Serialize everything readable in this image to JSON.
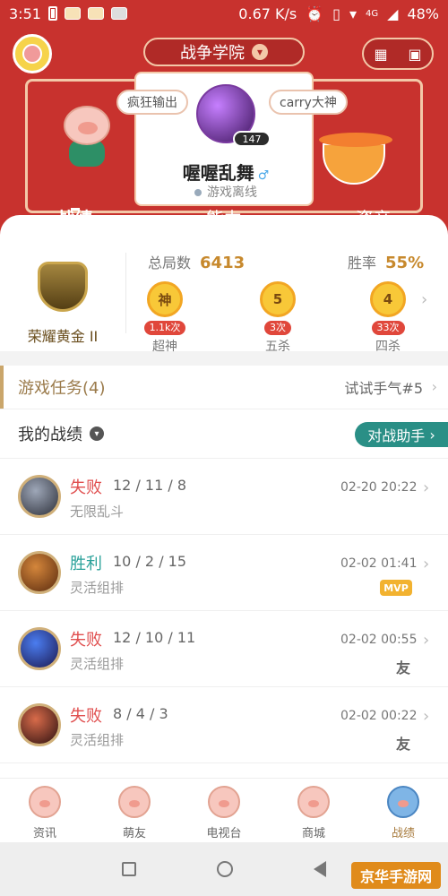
{
  "status_bar": {
    "time": "3:51",
    "speed": "0.67 K/s",
    "network": "4G",
    "battery": "48%"
  },
  "header": {
    "title": "战争学院",
    "top_right_icon": "calendar-icon",
    "nickname": "喔喔乱舞",
    "gender_symbol": "♂",
    "status": "游戏离线",
    "level": "147",
    "bubble_left": "疯狂输出",
    "bubble_right": "carry大神"
  },
  "tabs": {
    "items": [
      "战绩",
      "能力",
      "资产"
    ],
    "active_index": 0
  },
  "stats": {
    "rank": "荣耀黄金 II",
    "total_label": "总局数",
    "total_value": "6413",
    "winrate_label": "胜率",
    "winrate_value": "55%",
    "achievements": [
      {
        "badge": "神",
        "count": "1.1k次",
        "label": "超神"
      },
      {
        "badge": "5",
        "count": "3次",
        "label": "五杀"
      },
      {
        "badge": "4",
        "count": "33次",
        "label": "四杀"
      }
    ]
  },
  "task_bar": {
    "title": "游戏任务(4)",
    "link": "试试手气#5"
  },
  "record": {
    "title": "我的战绩",
    "assist_button": "对战助手",
    "rows": [
      {
        "result": "失败",
        "kda": "12 / 11 / 8",
        "mode": "无限乱斗",
        "time": "02-20 20:22",
        "tag": ""
      },
      {
        "result": "胜利",
        "kda": "10 / 2 / 15",
        "mode": "灵活组排",
        "time": "02-02 01:41",
        "tag": "MVP"
      },
      {
        "result": "失败",
        "kda": "12 / 10 / 11",
        "mode": "灵活组排",
        "time": "02-02 00:55",
        "tag": "友"
      },
      {
        "result": "失败",
        "kda": "8 / 4 / 3",
        "mode": "灵活组排",
        "time": "02-02 00:22",
        "tag": "友"
      }
    ]
  },
  "bottom_nav": {
    "items": [
      "资讯",
      "萌友",
      "电视台",
      "商城",
      "战绩"
    ],
    "active_index": 4
  },
  "watermark": "京华手游网"
}
